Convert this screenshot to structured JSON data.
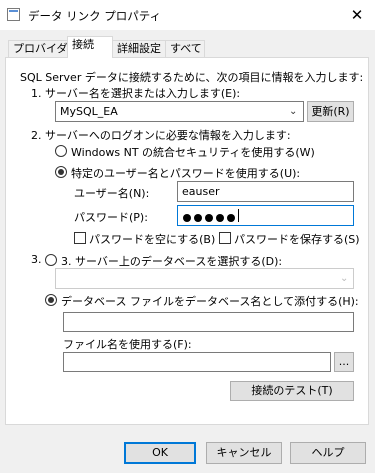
{
  "window": {
    "title": "データ リンク プロパティ",
    "close_glyph": "✕"
  },
  "tabs": [
    {
      "label": "プロバイダー"
    },
    {
      "label": "接続"
    },
    {
      "label": "詳細設定"
    },
    {
      "label": "すべて"
    }
  ],
  "connection": {
    "intro": "SQL Server データに接続するために、次の項目に情報を入力します:",
    "step1": {
      "label": "1. サーバー名を選択または入力します(E):",
      "server_value": "MySQL_EA",
      "refresh_label": "更新(R)"
    },
    "step2": {
      "label": "2. サーバーへのログオンに必要な情報を入力します:",
      "windows_auth_label": "Windows NT の統合セキュリティを使用する(W)",
      "specific_user_label": "特定のユーザー名とパスワードを使用する(U):",
      "username_label": "ユーザー名(N):",
      "username_value": "eauser",
      "password_label": "パスワード(P):",
      "password_length": 5,
      "blank_password_label": "パスワードを空にする(B)",
      "save_password_label": "パスワードを保存する(S)"
    },
    "step3": {
      "select_db_label": "3. サーバー上のデータベースを選択する(D):",
      "database_value": "",
      "attach_file_label": "データベース ファイルをデータベース名として添付する(H):",
      "attach_value": "",
      "use_filename_label": "ファイル名を使用する(F):",
      "filename_value": "",
      "browse_label": "...",
      "test_connection_label": "接続のテスト(T)"
    }
  },
  "footer": {
    "ok_label": "OK",
    "cancel_label": "キャンセル",
    "help_label": "ヘルプ"
  }
}
